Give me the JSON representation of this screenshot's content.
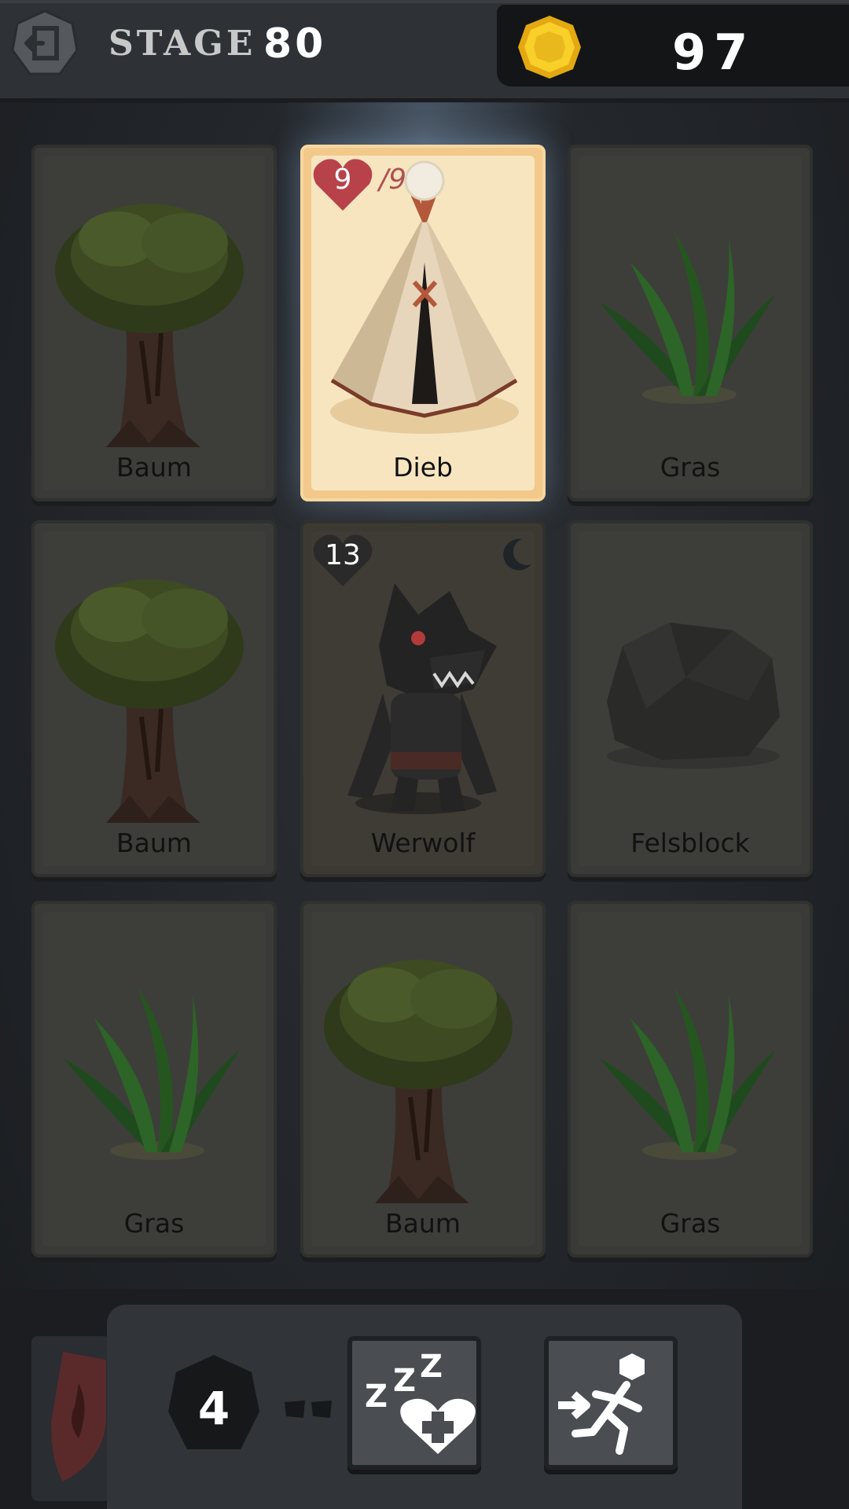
{
  "header": {
    "stage_label": "STAGE",
    "stage_number": "80",
    "coins": "97",
    "back_icon": "exit-door-icon",
    "coin_icon": "gold-coin-icon"
  },
  "grid": {
    "cards": [
      {
        "name": "Baum",
        "icon": "tree-icon"
      },
      {
        "name": "Dieb",
        "icon": "tent-icon",
        "hp": "9",
        "max_hp": "/9",
        "selected": true
      },
      {
        "name": "Gras",
        "icon": "grass-icon"
      },
      {
        "name": "Baum",
        "icon": "tree-icon"
      },
      {
        "name": "Werwolf",
        "icon": "werewolf-icon",
        "hp": "13",
        "night_icon": "moon-icon"
      },
      {
        "name": "Felsblock",
        "icon": "boulder-icon"
      },
      {
        "name": "Gras",
        "icon": "grass-icon"
      },
      {
        "name": "Baum",
        "icon": "tree-icon"
      },
      {
        "name": "Gras",
        "icon": "grass-icon"
      }
    ]
  },
  "footer": {
    "turn_counter": "4",
    "rest_icon": "sleep-heal-icon",
    "flee_icon": "flee-run-icon",
    "side_icon": "fire-shield-icon"
  },
  "colors": {
    "selected_card": "#f2c98a",
    "heart": "#b8424a",
    "coin": "#f6c21d"
  }
}
